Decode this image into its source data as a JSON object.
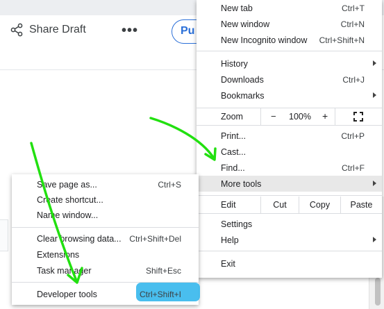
{
  "page": {
    "share_label": "Share Draft",
    "more_label": "•••",
    "publish_label": "Pu"
  },
  "main_menu": {
    "new_tab": {
      "label": "New tab",
      "shortcut": "Ctrl+T"
    },
    "new_window": {
      "label": "New window",
      "shortcut": "Ctrl+N"
    },
    "new_incognito": {
      "label": "New Incognito window",
      "shortcut": "Ctrl+Shift+N"
    },
    "history": {
      "label": "History"
    },
    "downloads": {
      "label": "Downloads",
      "shortcut": "Ctrl+J"
    },
    "bookmarks": {
      "label": "Bookmarks"
    },
    "zoom": {
      "label": "Zoom",
      "minus": "−",
      "value": "100%",
      "plus": "+"
    },
    "print": {
      "label": "Print...",
      "shortcut": "Ctrl+P"
    },
    "cast": {
      "label": "Cast..."
    },
    "find": {
      "label": "Find...",
      "shortcut": "Ctrl+F"
    },
    "more_tools": {
      "label": "More tools"
    },
    "edit": {
      "label": "Edit",
      "cut": "Cut",
      "copy": "Copy",
      "paste": "Paste"
    },
    "settings": {
      "label": "Settings"
    },
    "help": {
      "label": "Help"
    },
    "exit": {
      "label": "Exit"
    }
  },
  "sub_menu": {
    "save_page": {
      "label": "Save page as...",
      "shortcut": "Ctrl+S"
    },
    "create_shortcut": {
      "label": "Create shortcut..."
    },
    "name_window": {
      "label": "Name window..."
    },
    "clear_browsing": {
      "label": "Clear browsing data...",
      "shortcut": "Ctrl+Shift+Del"
    },
    "extensions": {
      "label": "Extensions"
    },
    "task_manager": {
      "label": "Task manager",
      "shortcut": "Shift+Esc"
    },
    "developer_tools": {
      "label": "Developer tools",
      "shortcut": "Ctrl+Shift+I"
    }
  },
  "colors": {
    "annotation_green": "#22e010",
    "annotation_blue": "#35b7ec",
    "accent_blue": "#2a6fd8"
  }
}
